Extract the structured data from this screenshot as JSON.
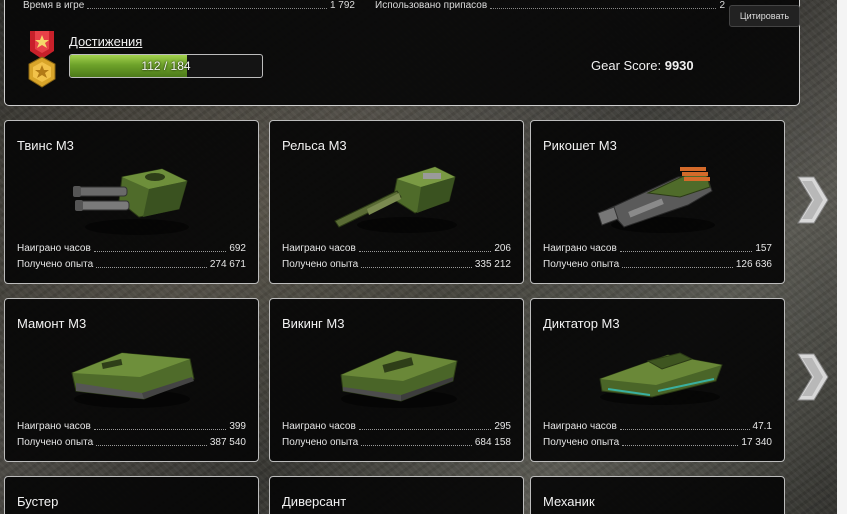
{
  "profile": {
    "stats_left": {
      "label": "Время в игре",
      "value": "1 792"
    },
    "stats_right": {
      "label": "Использовано припасов",
      "value": "2"
    },
    "quote_button": "Цитировать",
    "achievements": {
      "label": "Достижения",
      "current": 112,
      "total": 184,
      "progress_text": "112 / 184",
      "progress_fraction": 0.609
    },
    "gear_score": {
      "label": "Gear Score:",
      "value": "9930"
    }
  },
  "turret_cards": [
    {
      "name": "Твинс М3",
      "hours_label": "Наиграно часов",
      "hours": "692",
      "xp_label": "Получено опыта",
      "xp": "274 671",
      "icon": "twins-turret-icon"
    },
    {
      "name": "Рельса М3",
      "hours_label": "Наиграно часов",
      "hours": "206",
      "xp_label": "Получено опыта",
      "xp": "335 212",
      "icon": "railgun-turret-icon"
    },
    {
      "name": "Рикошет М3",
      "hours_label": "Наиграно часов",
      "hours": "157",
      "xp_label": "Получено опыта",
      "xp": "126 636",
      "icon": "ricochet-turret-icon"
    }
  ],
  "hull_cards": [
    {
      "name": "Мамонт М3",
      "hours_label": "Наиграно часов",
      "hours": "399",
      "xp_label": "Получено опыта",
      "xp": "387 540",
      "icon": "mammoth-hull-icon"
    },
    {
      "name": "Викинг М3",
      "hours_label": "Наиграно часов",
      "hours": "295",
      "xp_label": "Получено опыта",
      "xp": "684 158",
      "icon": "viking-hull-icon"
    },
    {
      "name": "Диктатор М3",
      "hours_label": "Наиграно часов",
      "hours": "47.1",
      "xp_label": "Получено опыта",
      "xp": "17 340",
      "icon": "dictator-hull-icon"
    }
  ],
  "module_cards": [
    {
      "name": "Бустер"
    },
    {
      "name": "Диверсант"
    },
    {
      "name": "Механик"
    }
  ],
  "icons": {
    "next_arrow": "chevron-right-icon",
    "medal": "medal-icon"
  },
  "colors": {
    "progress_green": "#7fb33a",
    "tank_green": "#4f6b2a",
    "panel_bg": "#080808"
  }
}
